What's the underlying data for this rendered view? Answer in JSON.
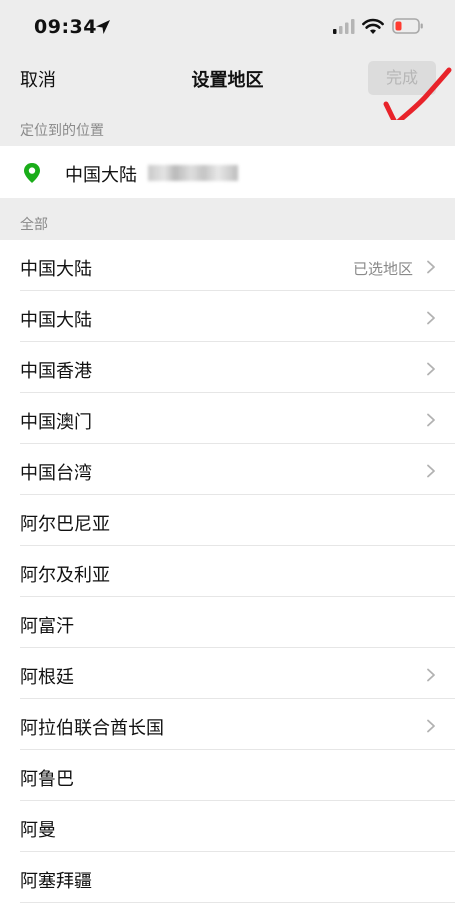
{
  "status_bar": {
    "time": "09:34",
    "location_icon": "location-arrow-icon",
    "signal_icon": "cellular-signal-icon",
    "wifi_icon": "wifi-icon",
    "battery_icon": "battery-low-icon",
    "battery_color": "#ff3b30"
  },
  "nav": {
    "cancel_label": "取消",
    "title": "设置地区",
    "done_label": "完成"
  },
  "annotation": {
    "icon": "red-checkmark-scribble",
    "color": "#e8232a"
  },
  "located": {
    "header": "定位到的位置",
    "icon": "map-pin-icon",
    "icon_color": "#1aad19",
    "region": "中国大陆"
  },
  "all": {
    "header": "全部",
    "items": [
      {
        "label": "中国大陆",
        "tag": "已选地区",
        "chevron": true
      },
      {
        "label": "中国大陆",
        "tag": "",
        "chevron": true
      },
      {
        "label": "中国香港",
        "tag": "",
        "chevron": true
      },
      {
        "label": "中国澳门",
        "tag": "",
        "chevron": true
      },
      {
        "label": "中国台湾",
        "tag": "",
        "chevron": true
      },
      {
        "label": "阿尔巴尼亚",
        "tag": "",
        "chevron": false
      },
      {
        "label": "阿尔及利亚",
        "tag": "",
        "chevron": false
      },
      {
        "label": "阿富汗",
        "tag": "",
        "chevron": false
      },
      {
        "label": "阿根廷",
        "tag": "",
        "chevron": true
      },
      {
        "label": "阿拉伯联合酋长国",
        "tag": "",
        "chevron": true
      },
      {
        "label": "阿鲁巴",
        "tag": "",
        "chevron": false
      },
      {
        "label": "阿曼",
        "tag": "",
        "chevron": false
      },
      {
        "label": "阿塞拜疆",
        "tag": "",
        "chevron": false
      }
    ]
  }
}
